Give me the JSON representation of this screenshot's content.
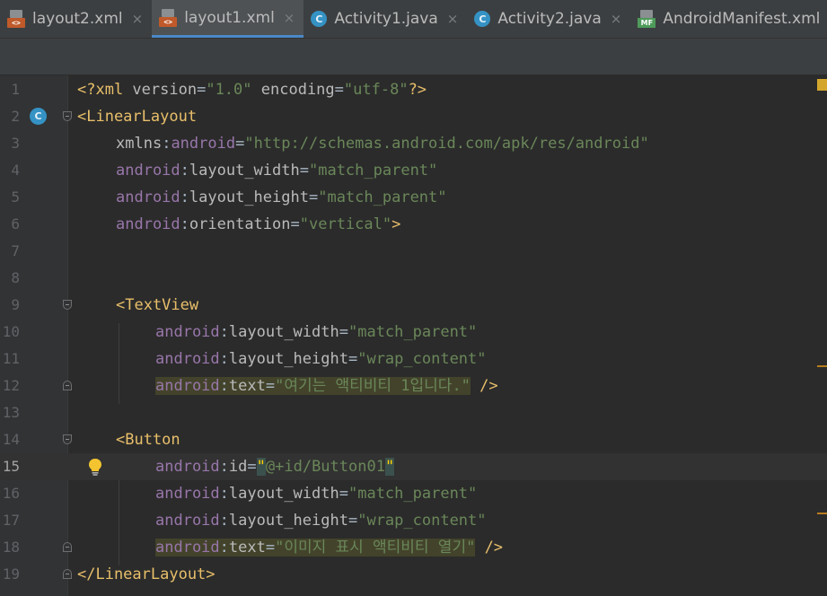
{
  "tabs": [
    {
      "label": "layout2.xml",
      "icon": "xml-layout-icon",
      "active": false
    },
    {
      "label": "layout1.xml",
      "icon": "xml-layout-icon",
      "active": true
    },
    {
      "label": "Activity1.java",
      "icon": "java-class-icon",
      "active": false
    },
    {
      "label": "Activity2.java",
      "icon": "java-class-icon",
      "active": false
    },
    {
      "label": "AndroidManifest.xml",
      "icon": "manifest-icon",
      "active": false
    }
  ],
  "tab_close_glyph": "×",
  "editor": {
    "current_line": 15,
    "lines": [
      {
        "n": "1"
      },
      {
        "n": "2"
      },
      {
        "n": "3"
      },
      {
        "n": "4"
      },
      {
        "n": "5"
      },
      {
        "n": "6"
      },
      {
        "n": "7"
      },
      {
        "n": "8"
      },
      {
        "n": "9"
      },
      {
        "n": "10"
      },
      {
        "n": "11"
      },
      {
        "n": "12"
      },
      {
        "n": "13"
      },
      {
        "n": "14"
      },
      {
        "n": "15"
      },
      {
        "n": "16"
      },
      {
        "n": "17"
      },
      {
        "n": "18"
      },
      {
        "n": "19"
      }
    ],
    "code": {
      "l1": {
        "open": "<?xml ",
        "a1": "version",
        "eq1": "=",
        "v1": "\"1.0\"",
        "sp": " ",
        "a2": "encoding",
        "eq2": "=",
        "v2": "\"utf-8\"",
        "close": "?>"
      },
      "l2": {
        "tag": "<LinearLayout"
      },
      "l3": {
        "n1": "xmlns",
        "c": ":",
        "ns": "android",
        "eq": "=",
        "v": "\"http://schemas.android.com/apk/res/android\""
      },
      "l4": {
        "ns": "android",
        "c": ":",
        "attr": "layout_width",
        "eq": "=",
        "v": "\"match_parent\""
      },
      "l5": {
        "ns": "android",
        "c": ":",
        "attr": "layout_height",
        "eq": "=",
        "v": "\"match_parent\""
      },
      "l6": {
        "ns": "android",
        "c": ":",
        "attr": "orientation",
        "eq": "=",
        "v": "\"vertical\"",
        "close": ">"
      },
      "l9": {
        "tag": "<TextView"
      },
      "l10": {
        "ns": "android",
        "c": ":",
        "attr": "layout_width",
        "eq": "=",
        "v": "\"match_parent\""
      },
      "l11": {
        "ns": "android",
        "c": ":",
        "attr": "layout_height",
        "eq": "=",
        "v": "\"wrap_content\""
      },
      "l12": {
        "ns": "android",
        "c": ":",
        "attr": "text",
        "eq": "=",
        "v": "\"여기는 액티비티 1입니다.\"",
        "close": " />"
      },
      "l14": {
        "tag": "<Button"
      },
      "l15": {
        "ns": "android",
        "c": ":",
        "attr": "id",
        "eq": "=",
        "q1": "\"",
        "v": "@+id/Button01",
        "q2": "\""
      },
      "l16": {
        "ns": "android",
        "c": ":",
        "attr": "layout_width",
        "eq": "=",
        "v": "\"match_parent\""
      },
      "l17": {
        "ns": "android",
        "c": ":",
        "attr": "layout_height",
        "eq": "=",
        "v": "\"wrap_content\""
      },
      "l18": {
        "ns": "android",
        "c": ":",
        "attr": "text",
        "eq": "=",
        "v": "\"이미지 표시 액티비티 열기\"",
        "close": " />"
      },
      "l19": {
        "tag": "</LinearLayout>"
      }
    },
    "gutter_class_badge": "C"
  },
  "colors": {
    "tag": "#e8bf6a",
    "attribute_namespace": "#9876aa",
    "attribute_name": "#bababa",
    "string_value": "#6a8759",
    "background": "#2b2b2b"
  }
}
